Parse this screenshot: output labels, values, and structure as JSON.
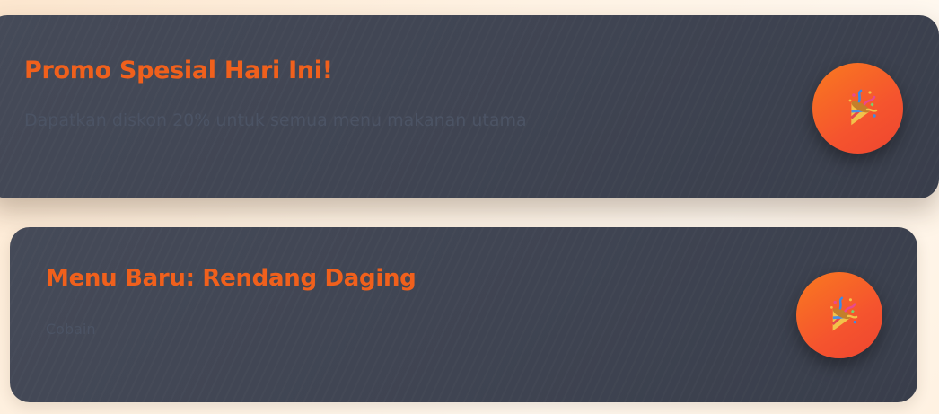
{
  "promos": [
    {
      "title": "Promo Spesial Hari Ini!",
      "description": "Dapatkan diskon 20% untuk semua menu makanan utama",
      "icon": "party-popper-icon"
    },
    {
      "title": "Menu Baru: Rendang Daging",
      "description": "Cobain",
      "icon": "party-popper-icon"
    }
  ],
  "colors": {
    "accent": "#f0601c",
    "card_background": "#404554",
    "badge_gradient_start": "#f97a20",
    "badge_gradient_end": "#ee4530",
    "page_background": "#fff3e4"
  }
}
